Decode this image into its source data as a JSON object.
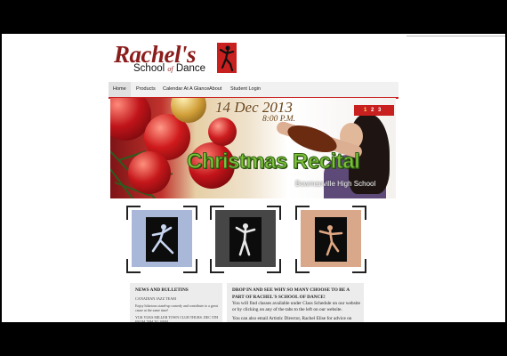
{
  "logo": {
    "script_text": "Rachel's",
    "subtitle_part1": "School",
    "subtitle_amp": "of",
    "subtitle_part2": "Dance"
  },
  "nav": {
    "items": [
      {
        "label": "Home",
        "active": true
      },
      {
        "label": "Products",
        "active": false
      },
      {
        "label": "Calendar At A Glance",
        "active": false
      },
      {
        "label": "About",
        "active": false
      },
      {
        "label": "Student Login",
        "active": false
      }
    ]
  },
  "banner": {
    "date": "14 Dec 2013",
    "time": "8:00 P.M.",
    "title": "Christmas Recital",
    "venue": "Bowmanville High School",
    "pager": [
      "1",
      "2",
      "3"
    ],
    "active_page": "1"
  },
  "thumbnails": [
    {
      "icon": "dancer-silhouette-icon",
      "bg": "#a9b7d8"
    },
    {
      "icon": "dancer-silhouette-icon",
      "bg": "#464646"
    },
    {
      "icon": "dancer-silhouette-icon",
      "bg": "#d9a88a"
    }
  ],
  "news": {
    "title": "NEWS AND BULLETINS",
    "item1_title": "CANADIAN JAZZ TEAM",
    "item1_text": "Enjoy hilarious stand-up comedy and contribute to a great cause at the same time!",
    "item2_text": "YUK YUKS MILLER TOWN CLUB THURS. DEC 5TH FROM 7PM TO 10PM"
  },
  "welcome": {
    "title": "DROP IN AND SEE WHY SO MANY CHOOSE TO BE A PART OF RACHEL'S SCHOOL OF DANCE!",
    "para1": "You will find classes available under Class Schedule on our website or by clicking on any of the tabs to the left on our website.",
    "para2": "You can also email Artistic Director, Rachel Elise for advice on"
  },
  "colors": {
    "accent": "#c81f1f",
    "brand_script": "#8b1c1c",
    "banner_title": "#7ec23a"
  }
}
